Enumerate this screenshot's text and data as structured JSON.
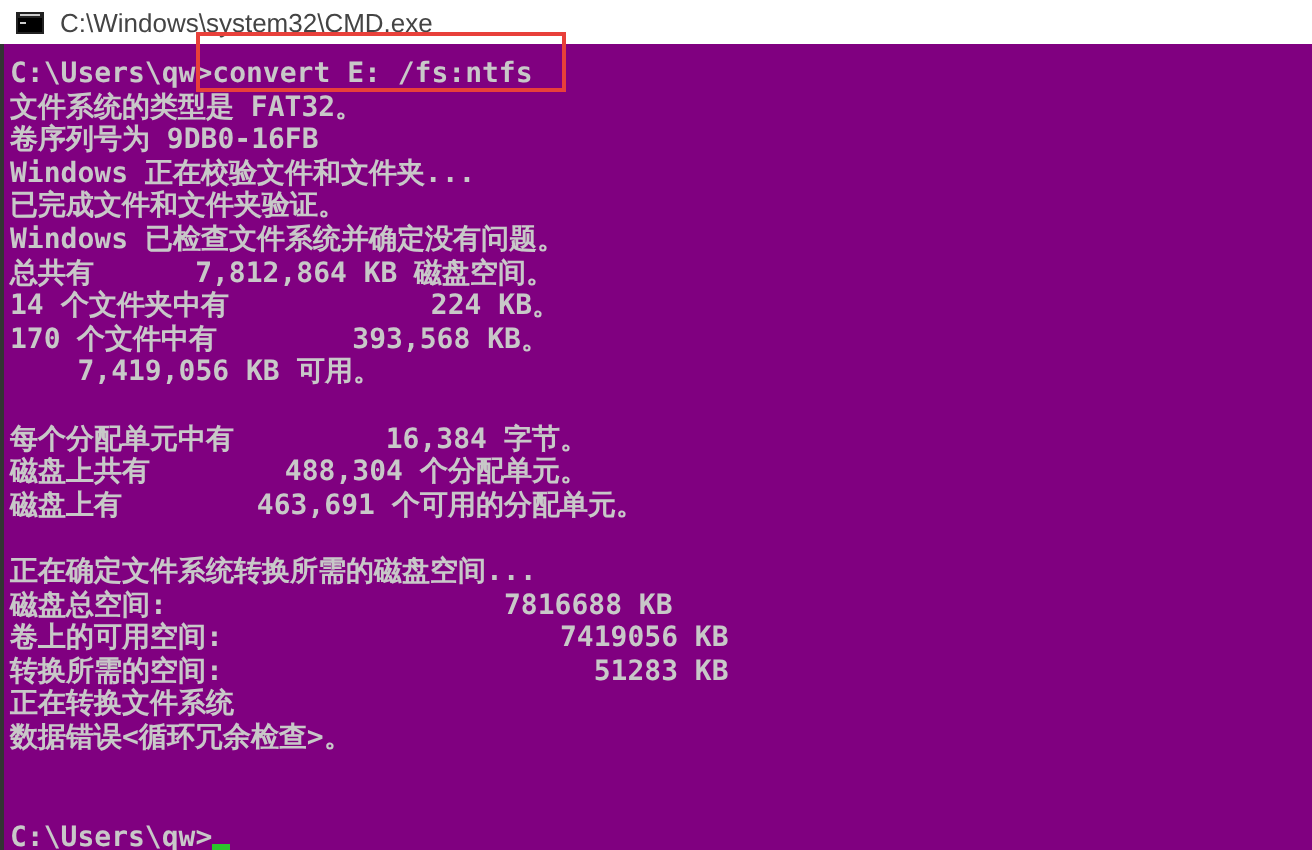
{
  "window": {
    "title": "C:\\Windows\\system32\\CMD.exe"
  },
  "console": {
    "blocks": [
      {
        "lines": [
          "C:\\Users\\qw>convert E: /fs:ntfs",
          "文件系统的类型是 FAT32。",
          "卷序列号为 9DB0-16FB",
          "Windows 正在校验文件和文件夹...",
          "已完成文件和文件夹验证。",
          "Windows 已检查文件系统并确定没有问题。",
          "总共有      7,812,864 KB 磁盘空间。",
          "14 个文件夹中有            224 KB。",
          "170 个文件中有        393,568 KB。",
          "    7,419,056 KB 可用。"
        ]
      },
      {
        "lines": [
          "每个分配单元中有         16,384 字节。",
          "磁盘上共有        488,304 个分配单元。",
          "磁盘上有        463,691 个可用的分配单元。"
        ]
      },
      {
        "lines": [
          "正在确定文件系统转换所需的磁盘空间...",
          "磁盘总空间:                    7816688 KB",
          "卷上的可用空间:                    7419056 KB",
          "转换所需的空间:                      51283 KB",
          "正在转换文件系统",
          "数据错误<循环冗余检查>。"
        ]
      }
    ],
    "prompt": "C:\\Users\\qw>"
  }
}
